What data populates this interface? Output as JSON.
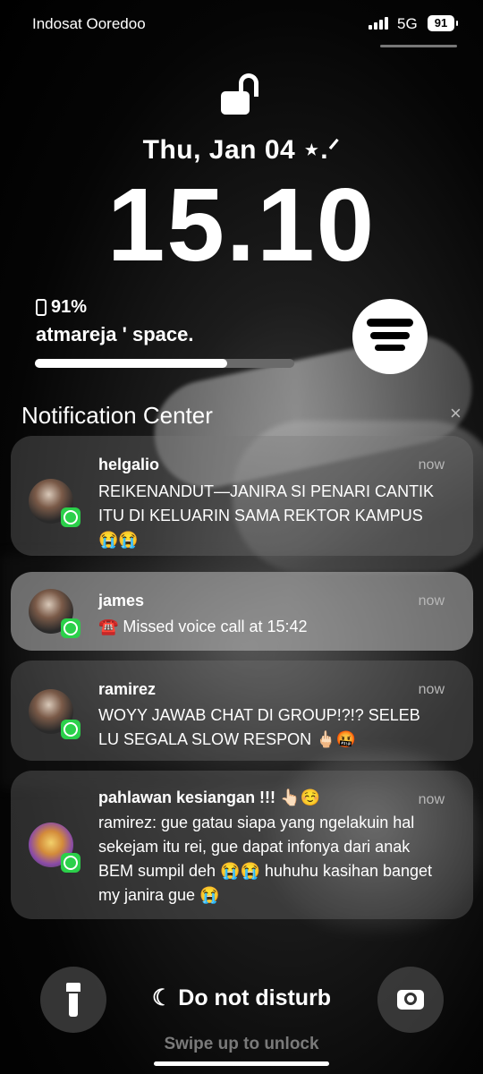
{
  "status": {
    "carrier": "Indosat Ooredoo",
    "network": "5G",
    "battery": "91"
  },
  "lockscreen": {
    "date": "Thu, Jan 04 ⋆.ᐟ",
    "time": "15.10"
  },
  "widget": {
    "battery_text": "91%",
    "title": "atmareja ' space.",
    "progress_fraction": 0.74
  },
  "notification_center": {
    "title": "Notification Center",
    "close_glyph": "×",
    "items": [
      {
        "app": "whatsapp",
        "sender": "helgalio",
        "time": "now",
        "message": "REIKENANDUT—JANIRA SI PENARI CANTIK ITU DI KELUARIN SAMA REKTOR KAMPUS 😭😭"
      },
      {
        "app": "whatsapp",
        "sender": "james",
        "time": "now",
        "message": "☎️ Missed voice call at 15:42"
      },
      {
        "app": "whatsapp",
        "sender": "ramirez",
        "time": "now",
        "message": "WOYY JAWAB CHAT DI GROUP!?!? SELEB LU SEGALA SLOW RESPON 🖕🏻🤬"
      },
      {
        "app": "whatsapp",
        "sender": "pahlawan kesiangan !!! 👆🏻☺️",
        "time": "now",
        "message": "ramirez: gue gatau siapa yang ngelakuin hal sekejam itu rei, gue dapat infonya dari anak BEM sumpil deh 😭😭 huhuhu kasihan banget my janira gue 😭"
      }
    ]
  },
  "bottom": {
    "dnd_label": "Do not disturb",
    "dnd_glyph": "☾",
    "swipe_label": "Swipe up to unlock"
  },
  "colors": {
    "whatsapp_green": "#2bd04a",
    "background": "#000000"
  }
}
